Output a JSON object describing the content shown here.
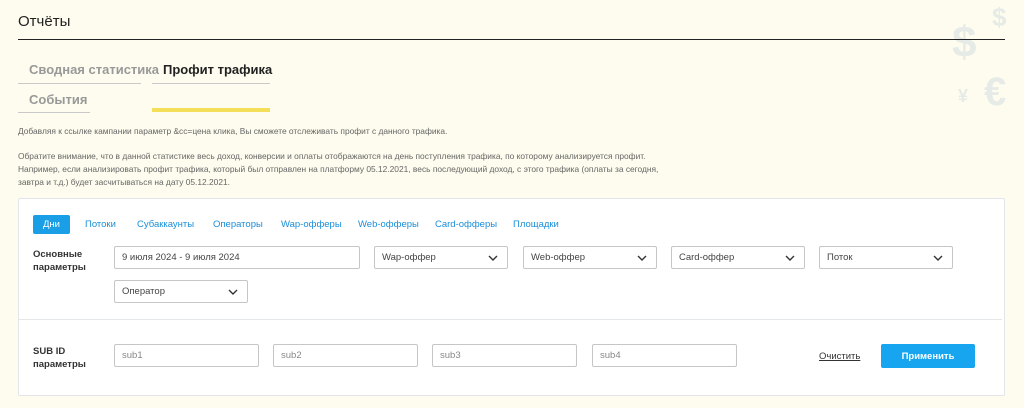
{
  "page": {
    "title": "Отчёты"
  },
  "tabs": [
    {
      "label": "Сводная статистика"
    },
    {
      "label": "Профит трафика"
    },
    {
      "label": "События"
    }
  ],
  "info": {
    "line1": "Добавляя к ссылке кампании параметр &cc=цена клика, Вы сможете отслеживать профит с данного трафика.",
    "line2": "Обратите внимание, что в данной статистике весь доход, конверсии и оплаты отображаются на день поступления трафика, по которому анализируется профит.",
    "line3": "Например, если анализировать профит трафика, который был отправлен на платформу 05.12.2021, весь последующий доход, с этого трафика (оплаты за сегодня,",
    "line4": "завтра и т.д.) будет засчитываться на дату 05.12.2021."
  },
  "panel_tabs": [
    {
      "label": "Дни"
    },
    {
      "label": "Потоки"
    },
    {
      "label": "Субаккаунты"
    },
    {
      "label": "Операторы"
    },
    {
      "label": "Wap-офферы"
    },
    {
      "label": "Web-офферы"
    },
    {
      "label": "Card-офферы"
    },
    {
      "label": "Площадки"
    }
  ],
  "main_params": {
    "label_line1": "Основные",
    "label_line2": "параметры",
    "date_range": "9 июля 2024 - 9 июля 2024",
    "selects": [
      {
        "value": "Wap-оффер"
      },
      {
        "value": "Web-оффер"
      },
      {
        "value": "Card-оффер"
      },
      {
        "value": "Поток"
      },
      {
        "value": "Оператор"
      }
    ]
  },
  "sub_params": {
    "label_line1": "SUB ID",
    "label_line2": "параметры",
    "inputs": [
      {
        "placeholder": "sub1"
      },
      {
        "placeholder": "sub2"
      },
      {
        "placeholder": "sub3"
      },
      {
        "placeholder": "sub4"
      }
    ],
    "clear_label": "Очистить",
    "apply_label": "Применить"
  },
  "colors": {
    "background": "#fdfcee",
    "accent_blue": "#16a5ee",
    "active_tab_underline": "#f3df5a"
  },
  "icons": [
    "chevron-down-icon",
    "dollar-icon",
    "euro-icon"
  ]
}
